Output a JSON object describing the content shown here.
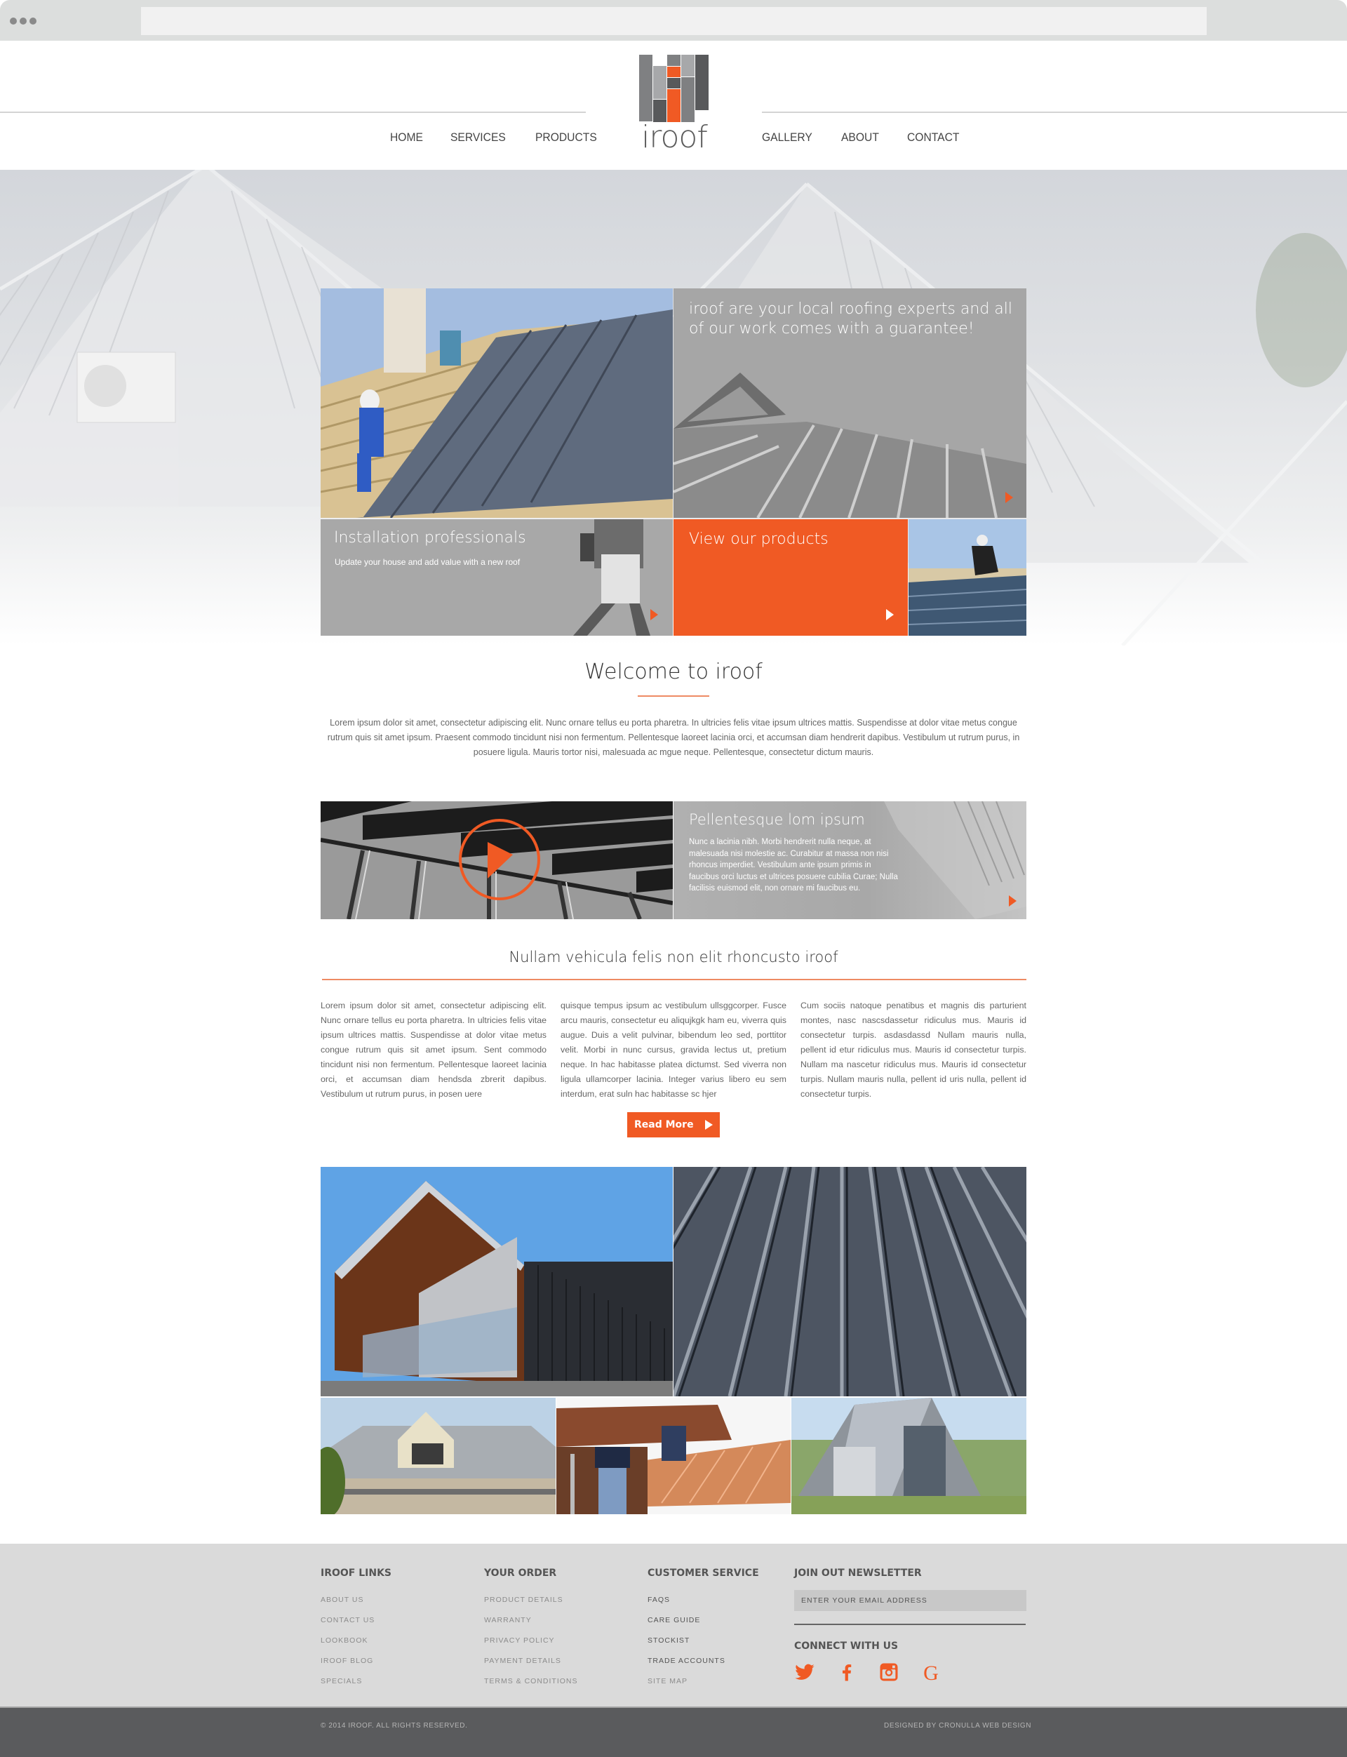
{
  "browser": {
    "menu_icon": "three-dots-icon",
    "url": ""
  },
  "brand": {
    "name": "iroof",
    "accent": "#f05a24"
  },
  "nav": {
    "left": [
      {
        "label": "HOME"
      },
      {
        "label": "SERVICES"
      },
      {
        "label": "PRODUCTS"
      }
    ],
    "right": [
      {
        "label": "GALLERY"
      },
      {
        "label": "ABOUT"
      },
      {
        "label": "CONTACT"
      }
    ]
  },
  "hero": {
    "tiles": {
      "guarantee": {
        "text": "iroof are your local roofing experts and all of our work comes with a guarantee!"
      },
      "installation": {
        "title": "Installation professionals",
        "subtitle": "Update your house and add value with a new roof"
      },
      "products": {
        "title": "View our products"
      }
    }
  },
  "welcome": {
    "title": "Welcome to iroof",
    "text": "Lorem ipsum dolor sit amet, consectetur adipiscing elit. Nunc ornare tellus eu porta pharetra. In ultricies felis vitae ipsum ultrices mattis. Suspendisse at dolor vitae metus congue rutrum quis sit amet ipsum. Praesent commodo tincidunt nisi non fermentum. Pellentesque laoreet lacinia orci, et accumsan diam hendrerit dapibus. Vestibulum ut rutrum purus, in posuere ligula. Mauris tortor nisi, malesuada ac mgue neque. Pellentesque, consectetur dictum mauris."
  },
  "video": {
    "play_icon": "play-circle-icon",
    "title": "Pellentesque lom ipsum",
    "text": "Nunc a lacinia nibh. Morbi hendrerit nulla neque, at malesuada nisi molestie ac. Curabitur at massa non nisi rhoncus imperdiet. Vestibulum ante ipsum primis in faucibus orci luctus et ultrices posuere cubilia Curae; Nulla facilisis euismod elit, non ornare mi faucibus eu."
  },
  "section2": {
    "title": "Nullam vehicula felis non elit rhoncusto iroof",
    "columns": [
      "Lorem ipsum dolor sit amet, consectetur adipiscing elit. Nunc ornare tellus eu porta pharetra. In ultricies felis vitae ipsum ultrices mattis. Suspendisse at dolor vitae metus congue rutrum quis sit amet ipsum. Sent commodo tincidunt nisi non fermentum. Pellentesque laoreet lacinia orci, et accumsan diam hendsda zbrerit dapibus. Vestibulum ut rutrum purus, in posen uere",
      "quisque tempus ipsum ac vestibulum ullsggcorper. Fusce arcu mauris, consectetur eu aliqujkgk ham eu, viverra quis augue. Duis a velit pulvinar, bibendum leo sed, porttitor velit. Morbi in nunc cursus, gravida lectus ut, pretium neque. In hac habitasse platea dictumst. Sed viverra non ligula ullamcorper lacinia. Integer varius libero eu sem interdum, erat suln hac habitasse sc hjer",
      "Cum sociis natoque penatibus et magnis dis parturient montes, nasc nascsdassetur ridiculus mus. Mauris id consectetur turpis. asdasdassd Nullam mauris nulla, pellent id etur ridiculus mus. Mauris id consectetur turpis. Nullam ma nascetur ridiculus mus. Mauris id consectetur turpis. Nullam mauris nulla, pellent id uris nulla, pellent id consectetur turpis."
    ],
    "read_more": "Read More"
  },
  "gallery": {
    "images": [
      {
        "name": "modern-gable-house"
      },
      {
        "name": "standing-seam-roof-closeup"
      },
      {
        "name": "house-with-dormer"
      },
      {
        "name": "workers-installing-copper-roof"
      },
      {
        "name": "a-frame-stone-house"
      }
    ]
  },
  "footer": {
    "columns": [
      {
        "title": "IROOF LINKS",
        "links": [
          "ABOUT US",
          "CONTACT US",
          "LOOKBOOK",
          "IROOF BLOG",
          "SPECIALS"
        ]
      },
      {
        "title": "YOUR ORDER",
        "links": [
          "PRODUCT DETAILS",
          "WARRANTY",
          "PRIVACY POLICY",
          "PAYMENT DETAILS",
          "TERMS & CONDITIONS"
        ]
      },
      {
        "title": "CUSTOMER SERVICE",
        "links": [
          "FAQS",
          "CARE GUIDE",
          "STOCKIST",
          "TRADE ACCOUNTS",
          "SITE MAP"
        ]
      }
    ],
    "newsletter": {
      "title": "JOIN OUT NEWSLETTER",
      "placeholder": "ENTER YOUR EMAIL ADDRESS",
      "value": ""
    },
    "connect": {
      "title": "CONNECT WITH US",
      "icons": [
        "twitter-icon",
        "facebook-icon",
        "instagram-icon",
        "google-icon"
      ]
    },
    "copyright": "© 2014 IROOF. ALL RIGHTS RESERVED.",
    "credit": "DESIGNED BY CRONULLA WEB DESIGN"
  }
}
